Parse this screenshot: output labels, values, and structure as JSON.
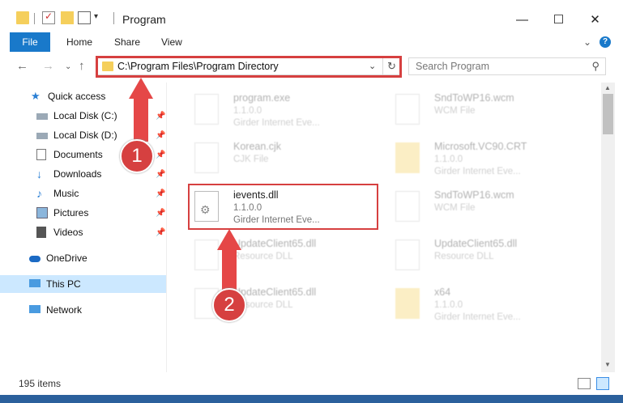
{
  "window": {
    "title": "Program"
  },
  "ribbon": {
    "file": "File",
    "home": "Home",
    "share": "Share",
    "view": "View"
  },
  "address": {
    "path": "C:\\Program Files\\Program Directory"
  },
  "search": {
    "placeholder": "Search Program"
  },
  "sidebar": {
    "items": [
      {
        "label": "Quick access",
        "icon": "star-icon"
      },
      {
        "label": "Local Disk (C:)",
        "icon": "drive-icon"
      },
      {
        "label": "Local Disk (D:)",
        "icon": "drive-icon"
      },
      {
        "label": "Documents",
        "icon": "documents-icon"
      },
      {
        "label": "Downloads",
        "icon": "download-icon"
      },
      {
        "label": "Music",
        "icon": "music-icon"
      },
      {
        "label": "Pictures",
        "icon": "pictures-icon"
      },
      {
        "label": "Videos",
        "icon": "videos-icon"
      },
      {
        "label": "OneDrive",
        "icon": "cloud-icon"
      },
      {
        "label": "This PC",
        "icon": "computer-icon"
      },
      {
        "label": "Network",
        "icon": "network-icon"
      }
    ]
  },
  "files": [
    {
      "name": "program.exe",
      "line2": "1.1.0.0",
      "line3": "Girder Internet Eve..."
    },
    {
      "name": "SndToWP16.wcm",
      "line2": "WCM File",
      "line3": ""
    },
    {
      "name": "Korean.cjk",
      "line2": "CJK File",
      "line3": ""
    },
    {
      "name": "Microsoft.VC90.CRT",
      "line2": "1.1.0.0",
      "line3": "Girder Internet Eve..."
    },
    {
      "name": "ievents.dll",
      "line2": "1.1.0.0",
      "line3": "Girder Internet Eve..."
    },
    {
      "name": "SndToWP16.wcm",
      "line2": "WCM File",
      "line3": ""
    },
    {
      "name": "UpdateClient65.dll",
      "line2": "Resource DLL",
      "line3": ""
    },
    {
      "name": "UpdateClient65.dll",
      "line2": "Resource DLL",
      "line3": ""
    },
    {
      "name": "UpdateClient65.dll",
      "line2": "Resource DLL",
      "line3": ""
    },
    {
      "name": "x64",
      "line2": "1.1.0.0",
      "line3": "Girder Internet Eve..."
    }
  ],
  "status": {
    "count": "195 items"
  },
  "annotations": {
    "step1": "1",
    "step2": "2",
    "color": "#d64040"
  }
}
